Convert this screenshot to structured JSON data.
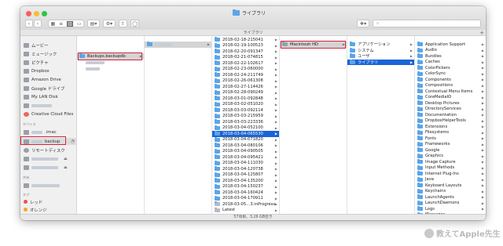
{
  "window": {
    "title": "ライブラリ",
    "path_label": "ライブラリ",
    "status": "57項目、3.26 GB空き"
  },
  "sidebar": {
    "favorites": [
      "ムービー",
      "ミュージック",
      "ピクチャ",
      "Dropbox",
      "Amazon Drive",
      "Google ドライブ",
      "My LAN Disk",
      "",
      "Creative Cloud Files"
    ],
    "devices_header": "デバイス",
    "devices": [
      ".imac",
      "backup",
      "リモートディスク",
      "",
      ""
    ],
    "shared_header": "共有",
    "tags_header": "タグ",
    "tags": [
      {
        "label": "レッド",
        "color": "#f0504a"
      },
      {
        "label": "オレンジ",
        "color": "#f5a623"
      }
    ]
  },
  "col1": {
    "items": [
      "Backups.backupdb"
    ]
  },
  "col3": {
    "items": [
      "2018-02-18-215041",
      "2018-02-19-100523",
      "2018-02-20-091347",
      "2018-02-21-074815",
      "2018-02-22-102617",
      "2018-02-23-060000",
      "2018-02-24-211749",
      "2018-02-26-061308",
      "2018-02-27-114426",
      "2018-02-28-090249",
      "2018-03-01-092848",
      "2018-03-02-051020",
      "2018-03-03-092114",
      "2018-03-03-215959",
      "2018-03-03-223336",
      "2018-03-04-052100",
      "2018-03-04-065530",
      "2018-03-04-071820",
      "2018-03-04-080106",
      "2018-03-04-090505",
      "2018-03-04-095421",
      "2018-03-04-111030",
      "2018-03-04-120738",
      "2018-03-04-125807",
      "2018-03-04-135200",
      "2018-03-04-150237",
      "2018-03-04-160424",
      "2018-03-04-170911",
      "2018-03-05…3.inProgress",
      "Latest"
    ]
  },
  "col4": {
    "items": [
      "Macintosh HD"
    ]
  },
  "col5": {
    "items": [
      "アプリケーション",
      "システム",
      "ユーザ",
      "ライブラリ"
    ]
  },
  "col6": {
    "items": [
      "Application Support",
      "Audio",
      "Bundles",
      "Caches",
      "ColorPickers",
      "ColorSync",
      "Components",
      "Compositions",
      "Contextual Menu Items",
      "CoreMediaIO",
      "Desktop Pictures",
      "DirectoryServices",
      "Documentation",
      "DropboxHelperTools",
      "Extensions",
      "Filesystems",
      "Fonts",
      "Frameworks",
      "Google",
      "Graphics",
      "Image Capture",
      "Input Methods",
      "Internet Plug-Ins",
      "Java",
      "Keyboard Layouts",
      "Keychains",
      "LaunchAgents",
      "LaunchDaemons",
      "Logs",
      "Messages"
    ]
  },
  "watermark": "教えてApple先生"
}
